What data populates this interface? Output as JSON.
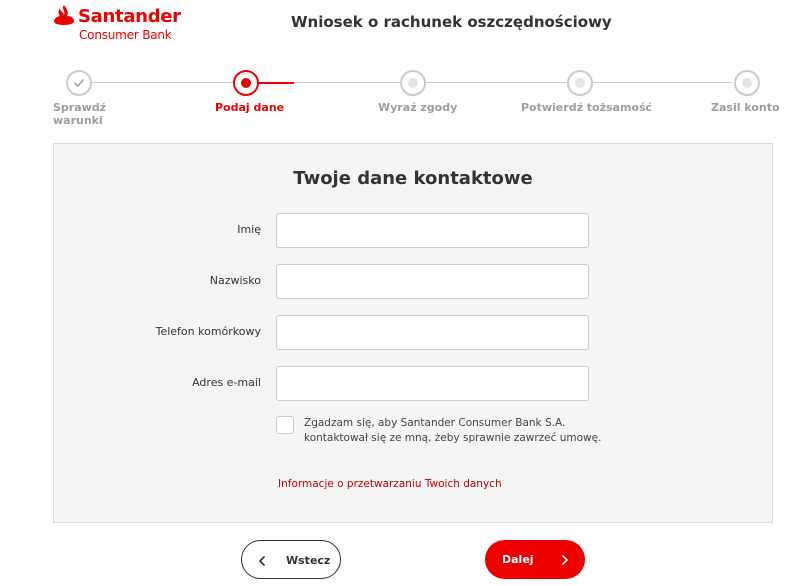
{
  "header": {
    "logo_name": "Santander",
    "logo_sub": "Consumer Bank",
    "title": "Wniosek o rachunek oszczędnościowy"
  },
  "stepper": {
    "steps": [
      {
        "label": "Sprawdź\nwarunki",
        "state": "done"
      },
      {
        "label": "Podaj dane",
        "state": "current"
      },
      {
        "label": "Wyraź zgody",
        "state": "pending"
      },
      {
        "label": "Potwierdź tożsamość",
        "state": "pending"
      },
      {
        "label": "Zasil konto",
        "state": "pending"
      }
    ]
  },
  "form": {
    "title": "Twoje dane kontaktowe",
    "fields": [
      {
        "label": "Imię",
        "value": "",
        "placeholder": ""
      },
      {
        "label": "Nazwisko",
        "value": "",
        "placeholder": ""
      },
      {
        "label": "Telefon komórkowy",
        "value": "",
        "placeholder": ""
      },
      {
        "label": "Adres e-mail",
        "value": "",
        "placeholder": ""
      }
    ],
    "consent": {
      "text": "Zgadzam się, aby Santander Consumer Bank S.A. kontaktował się ze mną, żeby sprawnie zawrzeć umowę.",
      "checked": false
    },
    "info_link": "Informacje o przetwarzaniu Twoich danych"
  },
  "nav": {
    "back_label": "Wstecz",
    "next_label": "Dalej"
  },
  "colors": {
    "brand": "#ec0000",
    "inactive": "#cccccc",
    "panel_bg": "#f5f5f5"
  }
}
